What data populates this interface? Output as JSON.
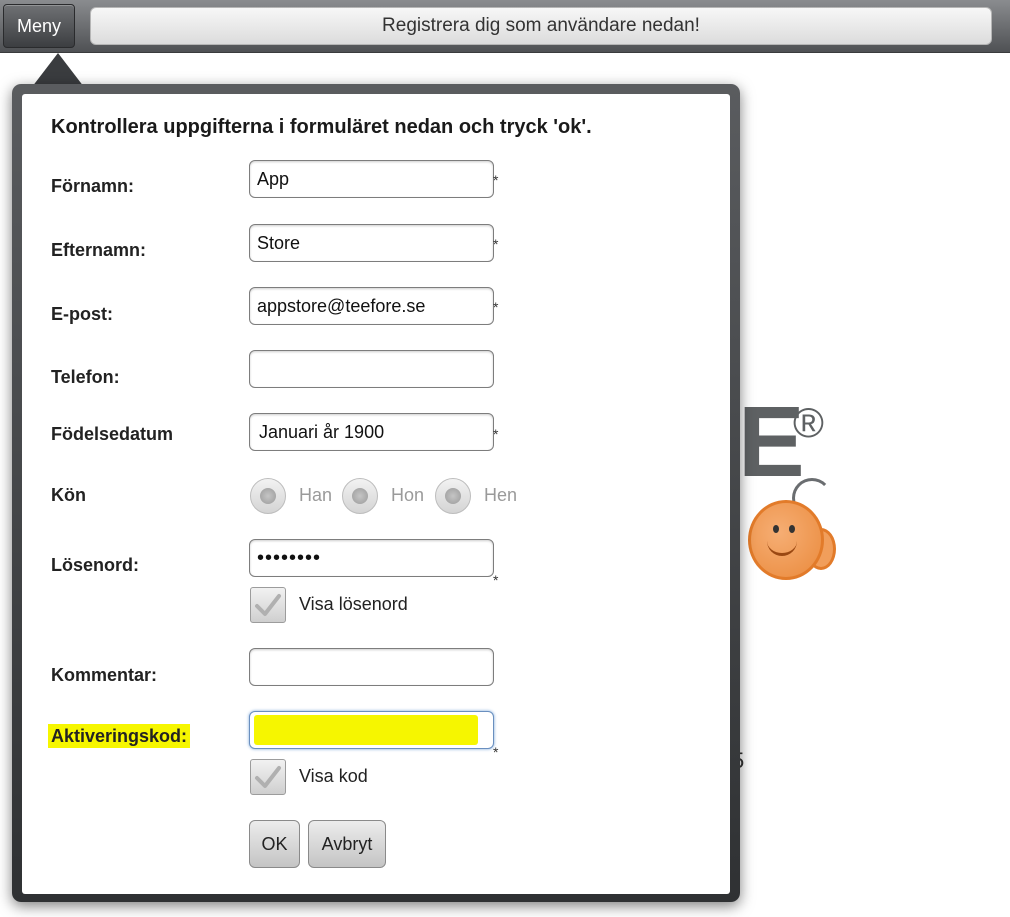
{
  "topbar": {
    "menu_label": "Meny",
    "title": "Registrera dig som användare nedan!"
  },
  "background": {
    "logo_letter": "E",
    "registered_mark": "®",
    "partial_digit": "5"
  },
  "form": {
    "heading": "Kontrollera uppgifterna i formuläret nedan och tryck 'ok'.",
    "required_marker": "*",
    "firstname": {
      "label": "Förnamn:",
      "value": "App"
    },
    "lastname": {
      "label": "Efternamn:",
      "value": "Store"
    },
    "email": {
      "label": "E-post:",
      "value": "appstore@teefore.se"
    },
    "phone": {
      "label": "Telefon:",
      "value": ""
    },
    "birthdate": {
      "label": "Födelsedatum",
      "value": "Januari år 1900"
    },
    "gender": {
      "label": "Kön",
      "options": [
        "Han",
        "Hon",
        "Hen"
      ]
    },
    "password": {
      "label": "Lösenord:",
      "masked_value": "••••••••",
      "show_label": "Visa lösenord"
    },
    "comment": {
      "label": "Kommentar:",
      "value": ""
    },
    "activation": {
      "label": "Aktiveringskod:",
      "show_label": "Visa kod",
      "highlight_color": "#f6f600"
    },
    "buttons": {
      "ok": "OK",
      "cancel": "Avbryt"
    }
  }
}
